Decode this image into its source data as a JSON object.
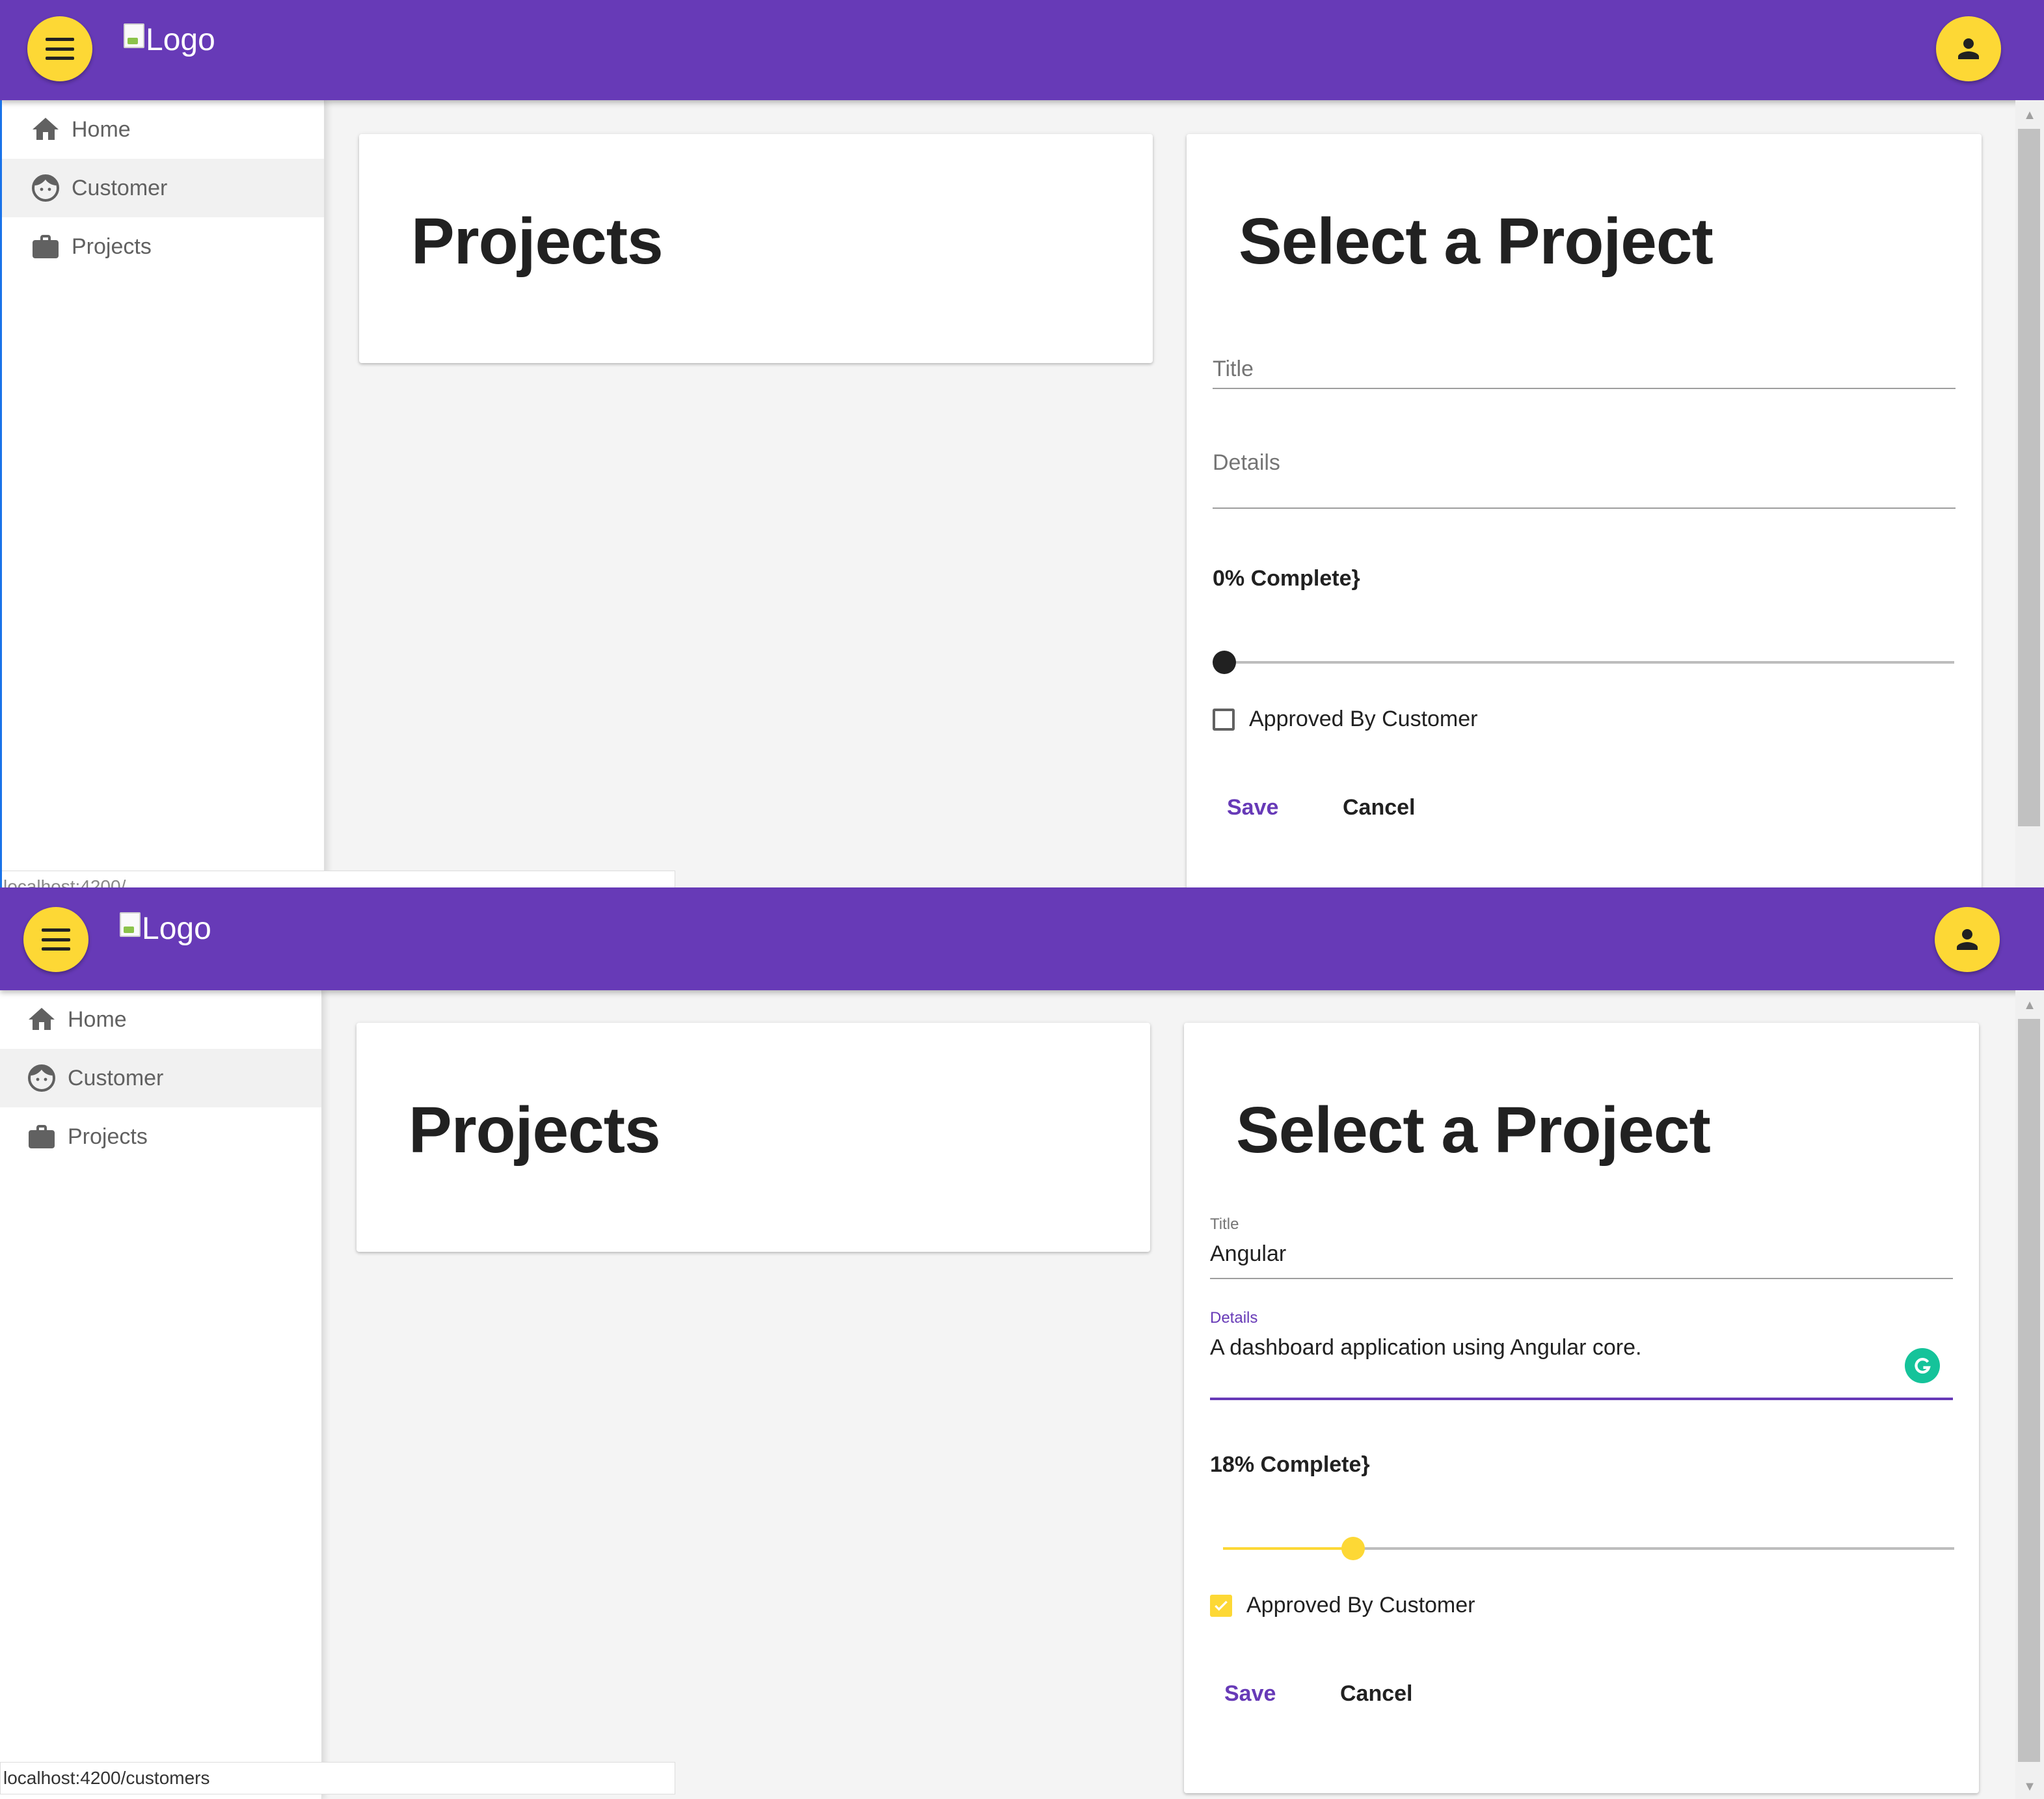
{
  "frames": [
    {
      "logo_text": "Logo",
      "nav": [
        {
          "label": "Home",
          "icon": "home-icon"
        },
        {
          "label": "Customer",
          "icon": "face-icon"
        },
        {
          "label": "Projects",
          "icon": "briefcase-icon"
        }
      ],
      "projects_card": {
        "title": "Projects"
      },
      "detail_card": {
        "title": "Select a Project",
        "title_field": {
          "label": "Title",
          "value": ""
        },
        "details_field": {
          "label": "Details",
          "value": ""
        },
        "progress_label": "0% Complete}",
        "progress_percent": 0,
        "approved_label": "Approved By Customer",
        "approved_checked": false,
        "save_label": "Save",
        "cancel_label": "Cancel"
      },
      "status_text": "localhost:4200/"
    },
    {
      "logo_text": "Logo",
      "nav": [
        {
          "label": "Home",
          "icon": "home-icon"
        },
        {
          "label": "Customer",
          "icon": "face-icon"
        },
        {
          "label": "Projects",
          "icon": "briefcase-icon"
        }
      ],
      "projects_card": {
        "title": "Projects"
      },
      "detail_card": {
        "title": "Select a Project",
        "title_field": {
          "label": "Title",
          "value": "Angular"
        },
        "details_field": {
          "label": "Details",
          "value": "A dashboard application using Angular core."
        },
        "progress_label": "18% Complete}",
        "progress_percent": 18,
        "approved_label": "Approved By Customer",
        "approved_checked": true,
        "save_label": "Save",
        "cancel_label": "Cancel"
      },
      "status_text": "localhost:4200/customers"
    }
  ],
  "colors": {
    "toolbar": "#673ab7",
    "accent": "#fdd835",
    "primary_text": "#673ab7"
  }
}
